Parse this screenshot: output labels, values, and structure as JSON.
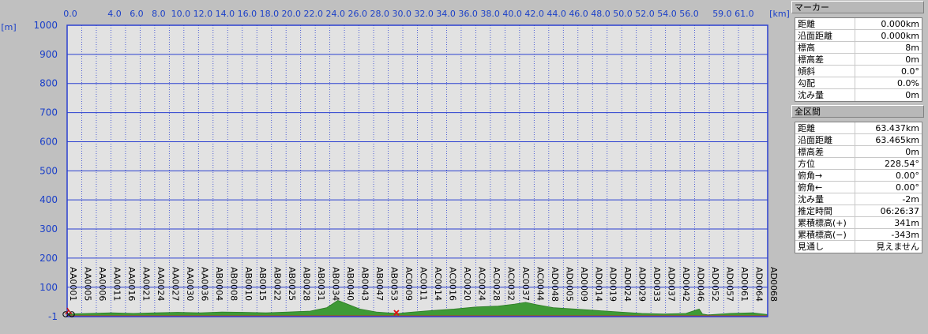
{
  "chart_data": {
    "type": "area",
    "x_unit": "[km]",
    "y_unit": "[m]",
    "ylim": [
      -1,
      1000
    ],
    "y_ticks": [
      "1000",
      "900",
      "800",
      "700",
      "600",
      "500",
      "400",
      "300",
      "200",
      "100",
      "-1"
    ],
    "x_ticks": [
      "0.0",
      "4.0",
      "6.0",
      "8.0",
      "10.0",
      "12.0",
      "14.0",
      "16.0",
      "18.0",
      "20.0",
      "22.0",
      "24.0",
      "26.0",
      "28.0",
      "30.0",
      "32.0",
      "34.0",
      "36.0",
      "38.0",
      "40.0",
      "42.0",
      "44.0",
      "46.0",
      "48.0",
      "50.0",
      "52.0",
      "54.0",
      "56.0",
      "59.0",
      "61.0"
    ],
    "waypoints": [
      "AA0001",
      "AA0005",
      "AA0006",
      "AA0011",
      "AA0016",
      "AA0021",
      "AA0024",
      "AA0027",
      "AA0030",
      "AA0036",
      "AB0004",
      "AB0008",
      "AB0010",
      "AB0015",
      "AB0022",
      "AB0025",
      "AB0028",
      "AB0031",
      "AB0034",
      "AB0040",
      "AB0043",
      "AB0047",
      "AB0053",
      "AC0009",
      "AC0011",
      "AC0014",
      "AC0016",
      "AC0020",
      "AC0024",
      "AC0028",
      "AC0032",
      "AC0037",
      "AC0044",
      "AD0048",
      "AD0005",
      "AD0009",
      "AD0014",
      "AD0019",
      "AD0024",
      "AD0029",
      "AD0033",
      "AD0037",
      "AD0042",
      "AD0046",
      "AD0052",
      "AD0057",
      "AD0061",
      "AD0064",
      "AD0068"
    ],
    "grid": true,
    "profile": {
      "x": [
        0,
        2,
        4,
        6,
        8,
        10,
        12,
        14,
        16,
        18,
        20,
        22,
        23.5,
        24.5,
        25.5,
        26.5,
        28,
        29,
        30,
        31,
        33,
        35,
        37,
        39,
        40.5,
        41.5,
        42.5,
        44,
        46,
        48,
        50,
        52,
        54,
        56,
        57.2,
        57.5,
        58,
        60,
        62,
        63.4
      ],
      "y": [
        8,
        10,
        12,
        10,
        12,
        14,
        12,
        15,
        14,
        12,
        15,
        18,
        30,
        55,
        40,
        25,
        15,
        12,
        10,
        14,
        20,
        25,
        32,
        35,
        42,
        48,
        40,
        30,
        25,
        20,
        15,
        10,
        8,
        10,
        25,
        8,
        5,
        10,
        12,
        6
      ]
    },
    "marker_km": 29.8
  },
  "marker_panel": {
    "title": "マーカー",
    "rows": [
      {
        "k": "距離",
        "v": "0.000km"
      },
      {
        "k": "沿面距離",
        "v": "0.000km"
      },
      {
        "k": "標高",
        "v": "8m"
      },
      {
        "k": "標高差",
        "v": "0m"
      },
      {
        "k": "傾斜",
        "v": "0.0°"
      },
      {
        "k": "勾配",
        "v": "0.0%"
      },
      {
        "k": "沈み量",
        "v": "0m"
      }
    ]
  },
  "total_panel": {
    "title": "全区間",
    "rows": [
      {
        "k": "距離",
        "v": "63.437km"
      },
      {
        "k": "沿面距離",
        "v": "63.465km"
      },
      {
        "k": "標高差",
        "v": "0m"
      },
      {
        "k": "方位",
        "v": "228.54°"
      },
      {
        "k": "俯角→",
        "v": "0.00°"
      },
      {
        "k": "俯角←",
        "v": "0.00°"
      },
      {
        "k": "沈み量",
        "v": "-2m"
      },
      {
        "k": "推定時間",
        "v": "06:26:37"
      },
      {
        "k": "累積標高(+)",
        "v": "341m"
      },
      {
        "k": "累積標高(−)",
        "v": "-343m"
      },
      {
        "k": "見通し",
        "v": "見えません"
      }
    ]
  },
  "colors": {
    "grid": "#2a3fd0",
    "axis_text": "#1a3fc8",
    "terrain": "#3f9a36",
    "plot_bg": "#e2e2e2",
    "marker": "#e01010"
  }
}
